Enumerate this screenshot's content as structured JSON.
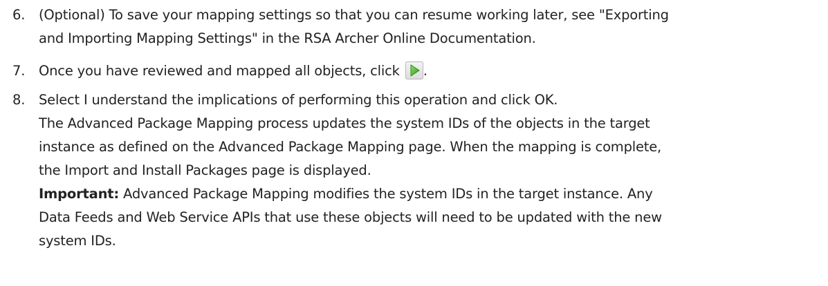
{
  "steps": [
    {
      "number": "6.",
      "lines": [
        "(Optional) To save your mapping settings so that you can resume working later, see \"Exporting",
        "and Importing Mapping Settings\" in the RSA Archer Online Documentation."
      ]
    },
    {
      "number": "7.",
      "text_before_icon": "Once you have reviewed and mapped all objects, click",
      "text_after_icon": ".",
      "icon": "play-icon",
      "icon_color": "#3fae2a"
    },
    {
      "number": "8.",
      "lines": [
        "Select I understand the implications of performing this operation and click OK.",
        "The Advanced Package Mapping process updates the system IDs of the objects in the target",
        "instance as defined on the Advanced Package Mapping page. When the mapping is complete,",
        "the Import and Install Packages page is displayed."
      ],
      "important_label": "Important:",
      "important_lines": [
        " Advanced Package Mapping modifies the system IDs in the target instance. Any",
        "Data Feeds and Web Service APIs that use these objects will need to be updated with the new",
        "system IDs."
      ]
    }
  ]
}
